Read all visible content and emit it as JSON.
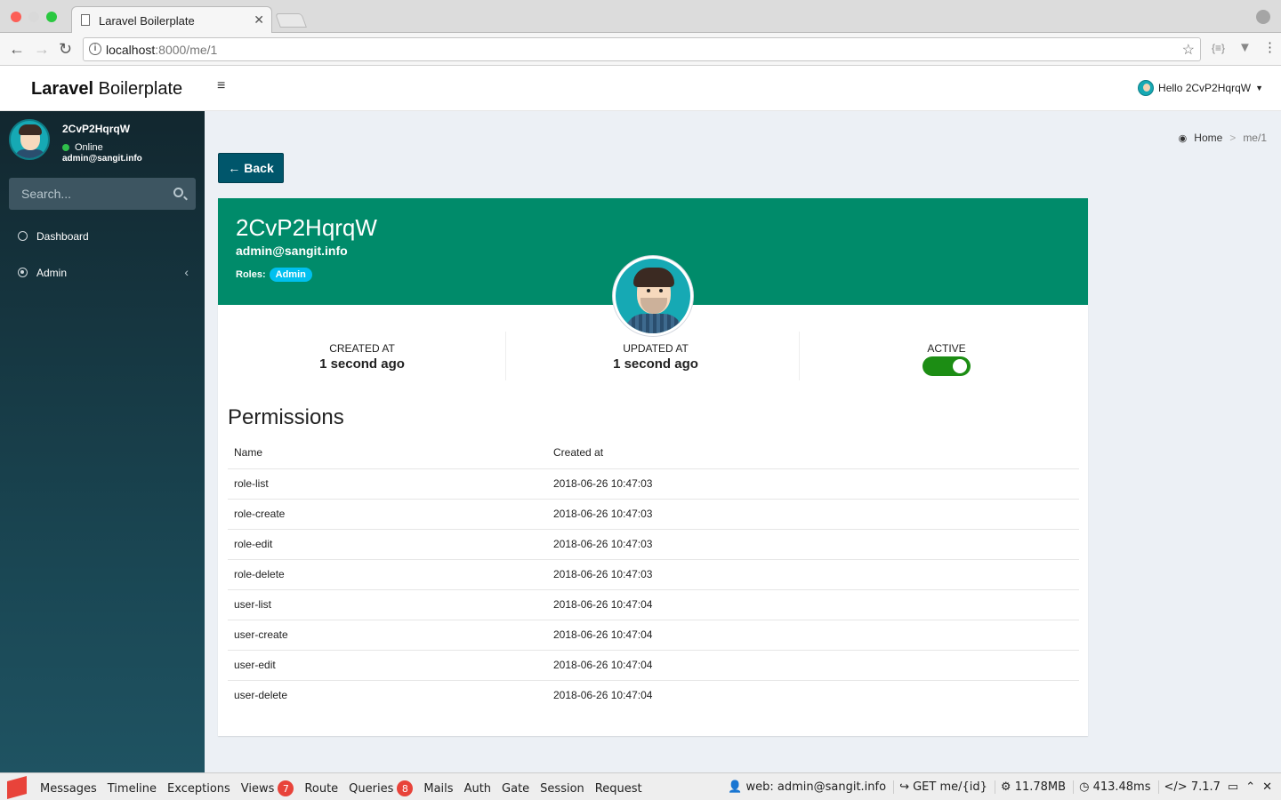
{
  "browser": {
    "tab_title": "Laravel Boilerplate",
    "url_host": "localhost",
    "url_path": ":8000/me/1"
  },
  "header": {
    "logo_bold": "Laravel",
    "logo_light": " Boilerplate",
    "user_greeting": "Hello 2CvP2HqrqW"
  },
  "sidebar": {
    "user_name": "2CvP2HqrqW",
    "status": "Online",
    "email": "admin@sangit.info",
    "search_placeholder": "Search...",
    "items": [
      {
        "label": "Dashboard",
        "icon": "dashboard-icon"
      },
      {
        "label": "Admin",
        "icon": "circle-dot-icon"
      }
    ]
  },
  "breadcrumb": {
    "home": "Home",
    "current": "me/1"
  },
  "back_button": "Back",
  "profile": {
    "name": "2CvP2HqrqW",
    "email": "admin@sangit.info",
    "roles_label": "Roles:",
    "role": "Admin",
    "header_color": "#008b6a"
  },
  "stats": {
    "created_label": "CREATED AT",
    "created_value": "1 second ago",
    "updated_label": "UPDATED AT",
    "updated_value": "1 second ago",
    "active_label": "ACTIVE",
    "active": true
  },
  "permissions": {
    "title": "Permissions",
    "columns": [
      "Name",
      "Created at"
    ],
    "rows": [
      [
        "role-list",
        "2018-06-26 10:47:03"
      ],
      [
        "role-create",
        "2018-06-26 10:47:03"
      ],
      [
        "role-edit",
        "2018-06-26 10:47:03"
      ],
      [
        "role-delete",
        "2018-06-26 10:47:03"
      ],
      [
        "user-list",
        "2018-06-26 10:47:04"
      ],
      [
        "user-create",
        "2018-06-26 10:47:04"
      ],
      [
        "user-edit",
        "2018-06-26 10:47:04"
      ],
      [
        "user-delete",
        "2018-06-26 10:47:04"
      ]
    ]
  },
  "debugbar": {
    "tabs": [
      {
        "label": "Messages"
      },
      {
        "label": "Timeline"
      },
      {
        "label": "Exceptions"
      },
      {
        "label": "Views",
        "badge": "7"
      },
      {
        "label": "Route"
      },
      {
        "label": "Queries",
        "badge": "8"
      },
      {
        "label": "Mails"
      },
      {
        "label": "Auth"
      },
      {
        "label": "Gate"
      },
      {
        "label": "Session"
      },
      {
        "label": "Request"
      }
    ],
    "user": "web: admin@sangit.info",
    "route": "GET me/{id}",
    "memory": "11.78MB",
    "time": "413.48ms",
    "php": "7.1.7"
  }
}
